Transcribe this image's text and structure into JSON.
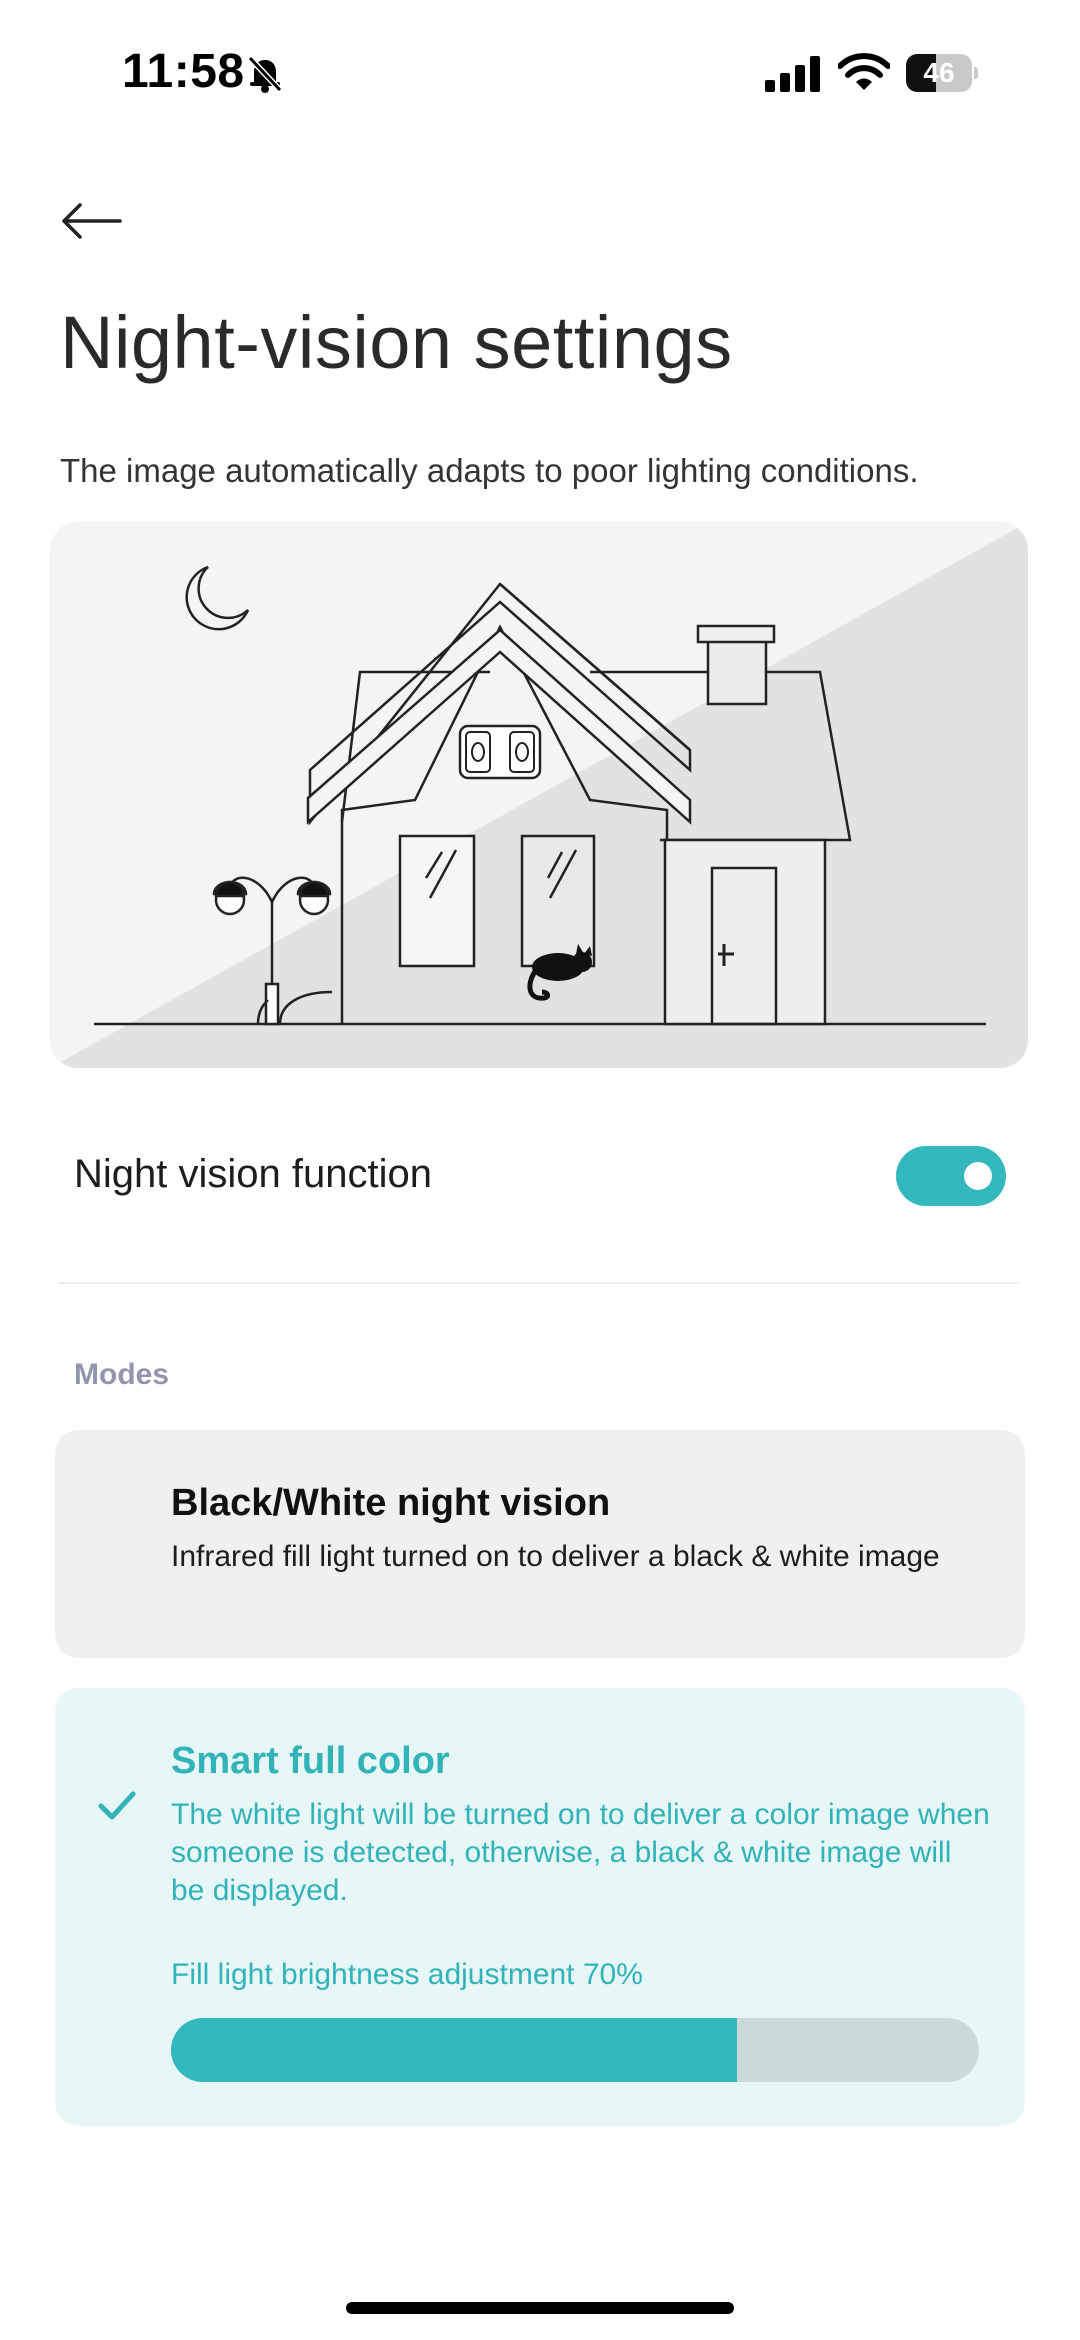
{
  "status_bar": {
    "time": "11:58",
    "battery_level": "46",
    "battery_fraction": 0.46,
    "icons": [
      "bell-slash-icon",
      "cellular-signal-icon",
      "wifi-icon",
      "battery-icon"
    ]
  },
  "header": {
    "back_icon": "arrow-left-icon",
    "title": "Night-vision settings",
    "subtitle": "The image automatically adapts to poor lighting conditions."
  },
  "illustration": {
    "description_icons": [
      "moon-icon",
      "house-icon",
      "camera-icon",
      "lamp-post-icon",
      "cat-icon"
    ]
  },
  "night_vision": {
    "label": "Night vision function",
    "enabled": true,
    "toggle_color": "#33b8bd"
  },
  "modes": {
    "header": "Modes",
    "items": [
      {
        "title": "Black/White night vision",
        "description": "Infrared fill light turned on to deliver a black & white image",
        "selected": false
      },
      {
        "title": "Smart full color",
        "description": "The white light will be turned on to deliver a color image when someone is detected, otherwise, a black & white image will be displayed.",
        "selected": true,
        "check_icon": "check-icon"
      }
    ],
    "brightness_label": "Fill light brightness adjustment 70%",
    "brightness_value": 0.7,
    "accent_color": "#31b3b8"
  }
}
